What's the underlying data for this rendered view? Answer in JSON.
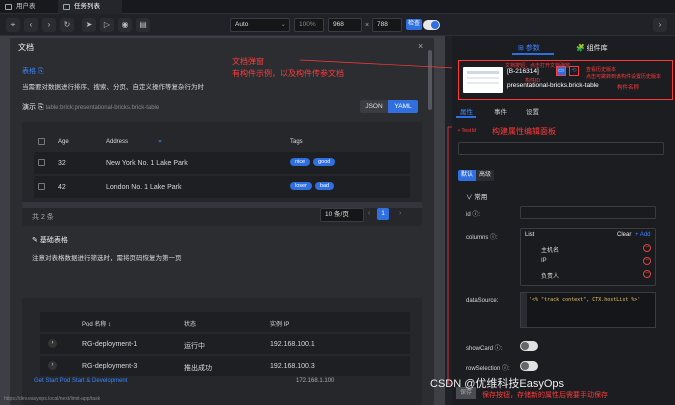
{
  "tabs": [
    {
      "label": "用户表",
      "active": false
    },
    {
      "label": "任务列表",
      "active": true
    }
  ],
  "toolbar": {
    "device": "Auto",
    "zoom": "100%",
    "width": "968",
    "times": "×",
    "height": "788",
    "check_label": "检查"
  },
  "modal": {
    "title": "文档",
    "section_title": "表格 ⎘",
    "desc": "当需要对数据进行排序、搜索、分页、自定义操作等复杂行为时",
    "demo_label": "演示 ⎘",
    "demo_path": "table:brick:presentational-bricks.brick-table",
    "format_json": "JSON",
    "format_yaml": "YAML",
    "table1": {
      "headers": [
        "Age",
        "Address",
        "Tags"
      ],
      "rows": [
        {
          "age": "32",
          "address": "New York No. 1 Lake Park",
          "tags": [
            "nice",
            "good"
          ]
        },
        {
          "age": "42",
          "address": "London No. 1 Lake Park",
          "tags": [
            "loser",
            "bad"
          ]
        }
      ]
    },
    "total": "共 2 条",
    "page_size": "10 条/页",
    "pager_prev": "‹",
    "page": "1",
    "pager_next": "›",
    "basic_title": "基础表格",
    "basic_desc": "注意对表格数据进行筛选时，需将页码恢复为第一页",
    "table2": {
      "headers": [
        "Pod 名称 ↕",
        "状态",
        "实例 IP"
      ],
      "rows": [
        {
          "name": "RG-deployment-1",
          "status": "运行中",
          "ip": "192.168.100.1"
        },
        {
          "name": "RG-deployment-3",
          "status": "推出成功",
          "ip": "192.168.100.3"
        }
      ]
    },
    "partial_row": {
      "name": "Get Start Pod Start & Development",
      "ip": "172.168.1.100"
    }
  },
  "status_url": "https://dev.easyops.local/next/limit-app/task",
  "annotations": {
    "modal": [
      "文档弹窗",
      "有构件示例，以及构件传参文档"
    ],
    "brick_id": "构件ID",
    "brick_name": "构件名称",
    "top_note": "文档按钮，点击打开文档弹窗",
    "side_note_1": "查看历史版本",
    "side_note_2": "点击可跳转到该构件设置历史版本",
    "panel": "构建属性编辑面板",
    "bottom": "保存按钮，存储新的属性后需要手动保存"
  },
  "right": {
    "top_tabs": [
      "⊞ 参数",
      "🧩 组件库"
    ],
    "brick_id": "[B-216314]",
    "brick_name": "presentational-bricks.brick-table",
    "tabs": [
      "属性",
      "事件",
      "设置"
    ],
    "testid_label": "• TestId",
    "mode_default": "默认",
    "mode_advanced": "高级",
    "group": "∨  常用",
    "id_label": "id ⓘ:",
    "columns_label": "columns ⓘ:",
    "list_label": "List",
    "clear_label": "Clear",
    "add_label": "+ Add",
    "list_items": [
      "主机名",
      "IP",
      "负责人"
    ],
    "datasource_label": "dataSource:",
    "datasource_code": "'<% \"track context\", CTX.hostList %>'",
    "showcard_label": "showCard ⓘ:",
    "rowsel_label": "rowSelection ⓘ:",
    "save_label": "保存"
  },
  "watermark": "CSDN @优维科技EasyOps",
  "colors": {
    "accent": "#2f6fe0",
    "annotation": "#ff3a3a",
    "danger": "#e04444"
  }
}
